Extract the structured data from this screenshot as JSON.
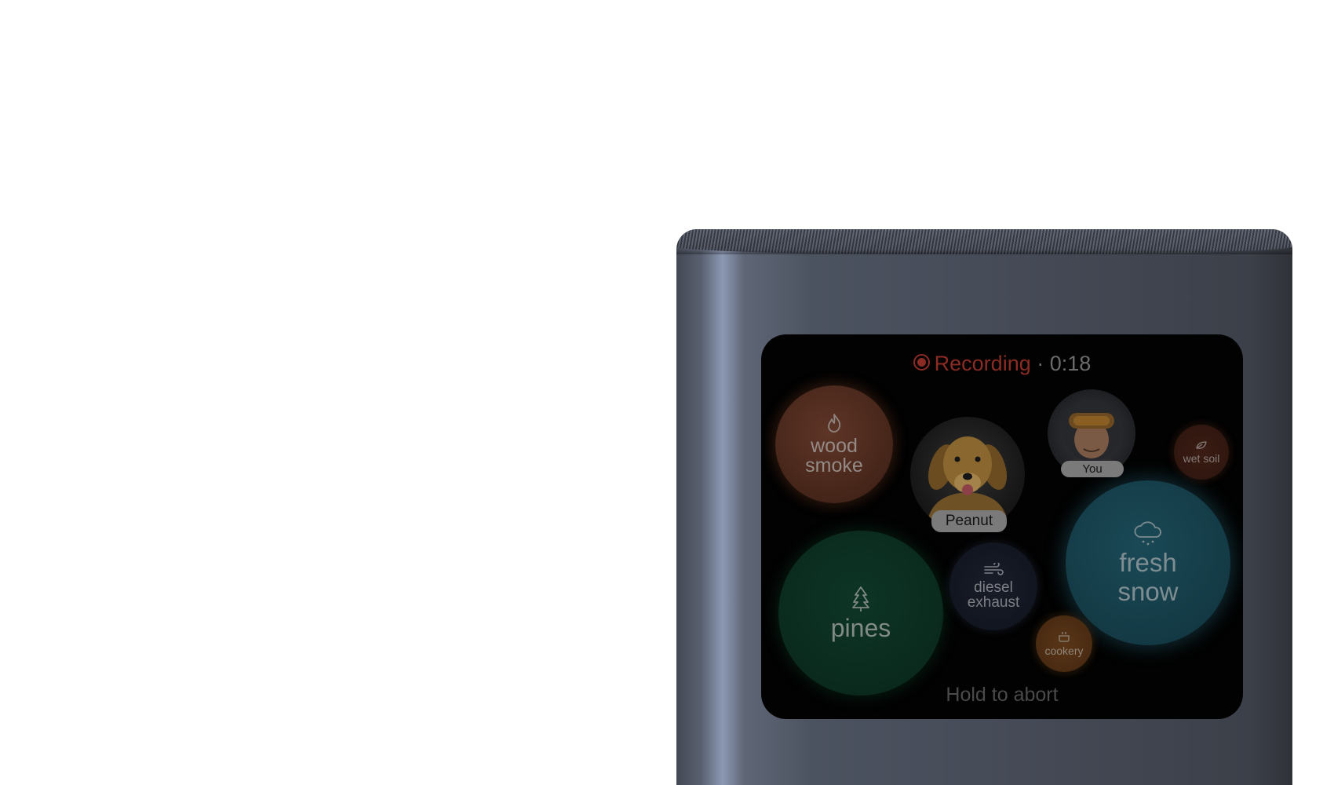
{
  "status": {
    "recording_label": "Recording",
    "separator": "·",
    "elapsed": "0:18",
    "color": "#8c2b24"
  },
  "scents": [
    {
      "id": "wood-smoke",
      "line1": "wood",
      "line2": "smoke",
      "icon": "flame-icon",
      "color": "#5e3527"
    },
    {
      "id": "pines",
      "line1": "pines",
      "icon": "pine-tree-icon",
      "color": "#0d3526"
    },
    {
      "id": "diesel-exhaust",
      "line1": "diesel",
      "line2": "exhaust",
      "icon": "wind-icon",
      "color": "#181d29"
    },
    {
      "id": "fresh-snow",
      "line1": "fresh",
      "line2": "snow",
      "icon": "snow-cloud-icon",
      "color": "#1a4956"
    },
    {
      "id": "wet-soil",
      "line1": "wet soil",
      "icon": "leaf-icon",
      "color": "#3b1d14"
    },
    {
      "id": "cookery",
      "line1": "cookery",
      "icon": "pot-icon",
      "color": "#5a3516"
    }
  ],
  "people": [
    {
      "id": "dog",
      "name": "Peanut"
    },
    {
      "id": "user",
      "name": "You"
    }
  ],
  "footer": {
    "abort_label": "Hold to abort"
  }
}
